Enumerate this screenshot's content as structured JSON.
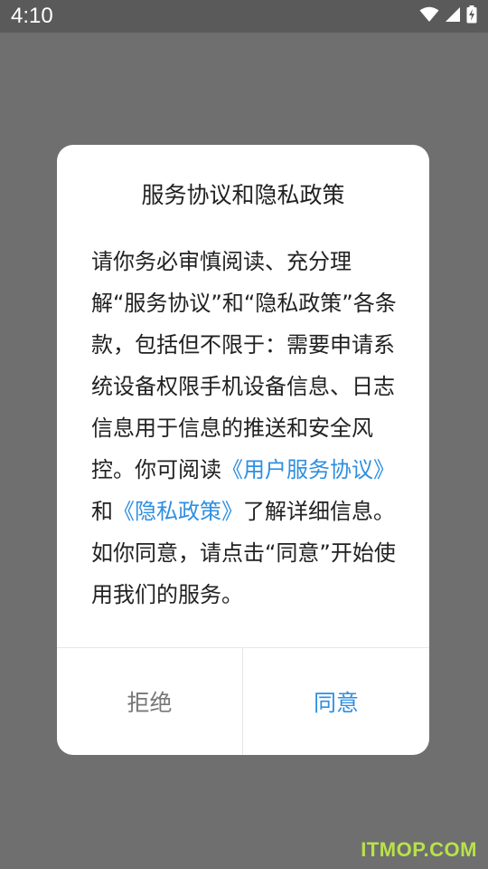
{
  "status_bar": {
    "time": "4:10",
    "icons": [
      "wifi-icon",
      "signal-icon",
      "battery-charging-icon"
    ]
  },
  "dialog": {
    "title": "服务协议和隐私政策",
    "body": {
      "part1": "请你务必审慎阅读、充分理解“服务协议”和“隐私政策”各条款，包括但不限于：需要申请系统设备权限手机设备信息、日志信息用于信息的推送和安全风控。你可阅读",
      "link_user_agreement": "《用户服务协议》",
      "and": "和",
      "link_privacy_policy": "《隐私政策》",
      "part2": "了解详细信息。如你同意，请点击“同意”开始使用我们的服务。"
    },
    "buttons": {
      "reject": "拒绝",
      "agree": "同意"
    }
  },
  "watermark": "ITMOP.COM",
  "colors": {
    "accent": "#2f8fe0",
    "overlay": "#6f6f6f",
    "reject_text": "#777777"
  }
}
